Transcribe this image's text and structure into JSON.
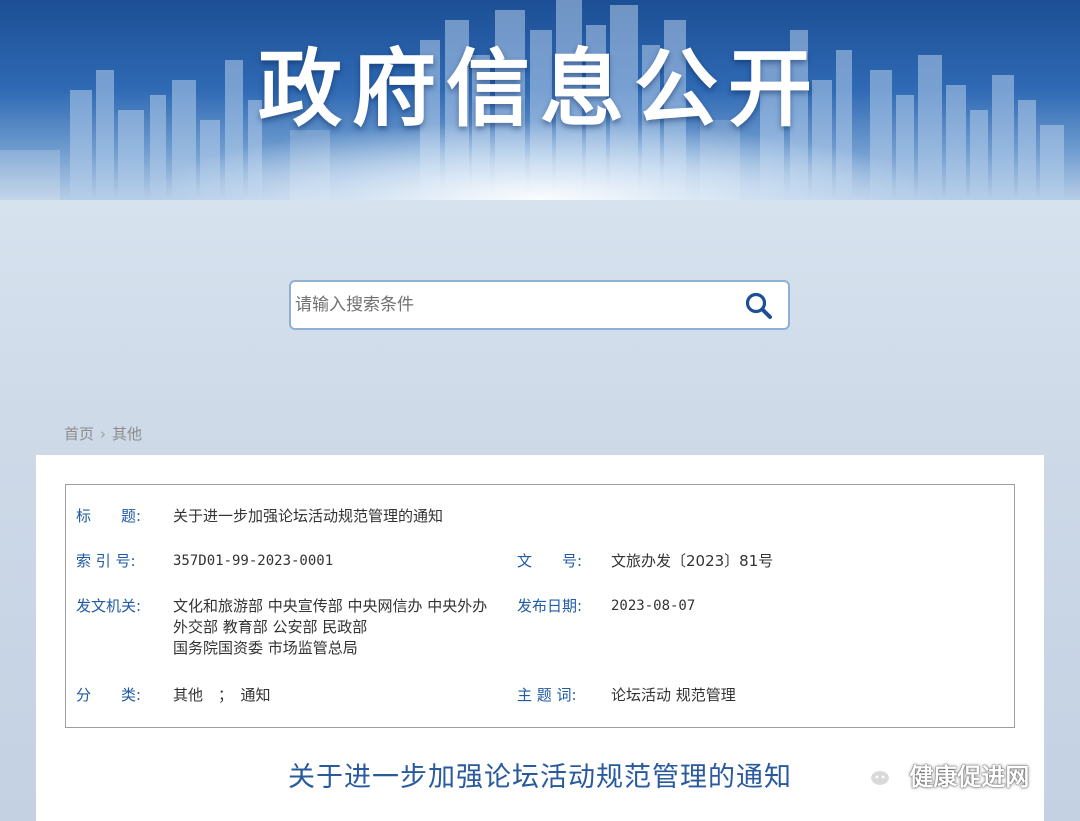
{
  "banner": {
    "title": "政府信息公开"
  },
  "search": {
    "placeholder": "请输入搜索条件",
    "icon": "search-icon"
  },
  "breadcrumb": {
    "home": "首页",
    "separator": "›",
    "current": "其他"
  },
  "meta": {
    "title_label": "标　　题:",
    "title_value": "关于进一步加强论坛活动规范管理的通知",
    "index_label": "索 引 号:",
    "index_value": "357D01-99-2023-0001",
    "docno_label": "文　　号:",
    "docno_value": "文旅办发〔2023〕81号",
    "issuer_label": "发文机关:",
    "issuer_lines": [
      "文化和旅游部 中央宣传部 中央网信办 中央外办",
      "外交部 教育部 公安部 民政部",
      "国务院国资委 市场监管总局"
    ],
    "date_label": "发布日期:",
    "date_value": "2023-08-07",
    "category_label": "分　　类:",
    "category_value": "其他　；　通知",
    "keywords_label": "主 题 词:",
    "keywords_value": "论坛活动 规范管理"
  },
  "document": {
    "title": "关于进一步加强论坛活动规范管理的通知"
  },
  "watermark": {
    "text": "健康促进网",
    "icon": "wechat-icon"
  },
  "colors": {
    "label_blue": "#1f5aa5",
    "title_blue": "#2a5a9e",
    "banner_blue": "#1c4f95"
  }
}
